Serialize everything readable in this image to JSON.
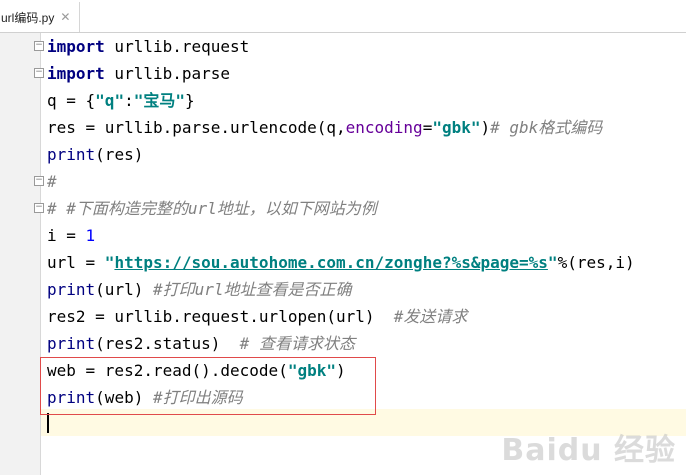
{
  "tab": {
    "title": "url编码.py",
    "close_glyph": "✕"
  },
  "code_lines": [
    [
      {
        "t": "import",
        "c": "kw"
      },
      {
        "t": " urllib.request",
        "c": ""
      }
    ],
    [
      {
        "t": "import",
        "c": "kw"
      },
      {
        "t": " urllib.parse",
        "c": ""
      }
    ],
    [
      {
        "t": "q = {",
        "c": ""
      },
      {
        "t": "\"q\"",
        "c": "str"
      },
      {
        "t": ":",
        "c": ""
      },
      {
        "t": "\"宝马\"",
        "c": "str"
      },
      {
        "t": "}",
        "c": ""
      }
    ],
    [
      {
        "t": "res = urllib.parse.urlencode(q,",
        "c": ""
      },
      {
        "t": "encoding",
        "c": "param"
      },
      {
        "t": "=",
        "c": ""
      },
      {
        "t": "\"gbk\"",
        "c": "str"
      },
      {
        "t": ")",
        "c": ""
      },
      {
        "t": "# gbk格式编码",
        "c": "cm"
      }
    ],
    [
      {
        "t": "print",
        "c": "builtin"
      },
      {
        "t": "(res)",
        "c": ""
      }
    ],
    [
      {
        "t": "#",
        "c": "cm"
      }
    ],
    [
      {
        "t": "# #下面构造完整的url地址，以如下网站为例",
        "c": "cm"
      }
    ],
    [
      {
        "t": "i = ",
        "c": ""
      },
      {
        "t": "1",
        "c": "num"
      }
    ],
    [
      {
        "t": "url = ",
        "c": ""
      },
      {
        "t": "\"",
        "c": "str"
      },
      {
        "t": "https://sou.autohome.com.cn/zonghe?%s&page=%s",
        "c": "url"
      },
      {
        "t": "\"",
        "c": "str"
      },
      {
        "t": "%(res,i)",
        "c": ""
      }
    ],
    [
      {
        "t": "print",
        "c": "builtin"
      },
      {
        "t": "(url) ",
        "c": ""
      },
      {
        "t": "#打印url地址查看是否正确",
        "c": "cm"
      }
    ],
    [
      {
        "t": "res2 = urllib.request.urlopen(url)  ",
        "c": ""
      },
      {
        "t": "#发送请求",
        "c": "cm"
      }
    ],
    [
      {
        "t": "print",
        "c": "builtin"
      },
      {
        "t": "(res2.status)  ",
        "c": ""
      },
      {
        "t": "# 查看请求状态",
        "c": "cm"
      }
    ],
    [
      {
        "t": "web = res2.read().decode(",
        "c": ""
      },
      {
        "t": "\"gbk\"",
        "c": "str"
      },
      {
        "t": ")",
        "c": ""
      }
    ],
    [
      {
        "t": "print",
        "c": "builtin"
      },
      {
        "t": "(web) ",
        "c": ""
      },
      {
        "t": "#打印出源码",
        "c": "cm"
      }
    ],
    [
      {
        "t": "",
        "c": ""
      }
    ]
  ],
  "watermark": "Baidu 经验"
}
